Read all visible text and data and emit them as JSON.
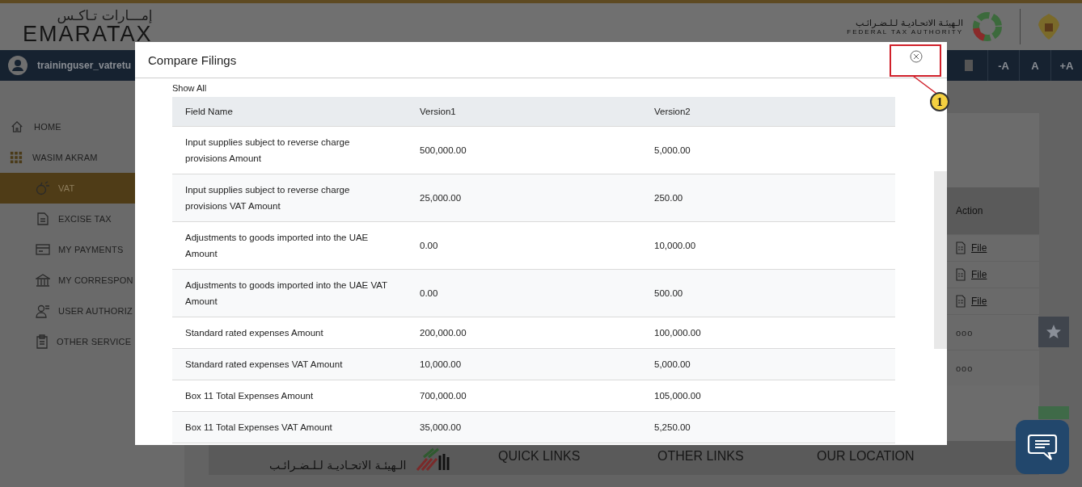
{
  "header": {
    "logo_arabic": "إمـــارات تـاكـس",
    "logo_text": "EMARATAX",
    "authority_arabic": "الـهيئـة الاتحـاديـة لـلـضـرائـب",
    "authority_english": "FEDERAL TAX AUTHORITY"
  },
  "navbar": {
    "username": "traininguser_vatretu",
    "font_buttons": [
      "-A",
      "A",
      "+A"
    ]
  },
  "sidebar": {
    "items": [
      {
        "label": "HOME",
        "selected": false
      },
      {
        "label": "WASIM AKRAM",
        "selected": false,
        "children": [
          {
            "label": "VAT",
            "selected": true
          },
          {
            "label": "EXCISE TAX",
            "selected": false
          },
          {
            "label": "MY PAYMENTS",
            "selected": false
          },
          {
            "label": "MY CORRESPON",
            "selected": false
          },
          {
            "label": "USER AUTHORIZ",
            "selected": false
          },
          {
            "label": "OTHER SERVICE",
            "selected": false
          }
        ]
      }
    ]
  },
  "background_table": {
    "column": "Action",
    "rows": [
      {
        "kind": "link",
        "text": "File"
      },
      {
        "kind": "link",
        "text": "File"
      },
      {
        "kind": "link",
        "text": "File"
      },
      {
        "kind": "more",
        "text": "ooo"
      },
      {
        "kind": "more",
        "text": "ooo"
      }
    ]
  },
  "footer": {
    "authority_arabic": "الـهيئـة الاتحـاديـة لـلـضـرائـب",
    "headings": [
      "QUICK LINKS",
      "OTHER LINKS",
      "OUR LOCATION"
    ]
  },
  "modal": {
    "title": "Compare Filings",
    "show_all": "Show All",
    "columns": [
      "Field Name",
      "Version1",
      "Version2"
    ],
    "rows": [
      [
        "Input supplies subject to reverse charge provisions Amount",
        "500,000.00",
        "5,000.00"
      ],
      [
        "Input supplies subject to reverse charge provisions VAT Amount",
        "25,000.00",
        "250.00"
      ],
      [
        "Adjustments to goods imported into the UAE Amount",
        "0.00",
        "10,000.00"
      ],
      [
        "Adjustments to goods imported into the UAE VAT Amount",
        "0.00",
        "500.00"
      ],
      [
        "Standard rated expenses Amount",
        "200,000.00",
        "100,000.00"
      ],
      [
        "Standard rated expenses VAT Amount",
        "10,000.00",
        "5,000.00"
      ],
      [
        "Box 11 Total Expenses Amount",
        "700,000.00",
        "105,000.00"
      ],
      [
        "Box 11 Total Expenses VAT Amount",
        "35,000.00",
        "5,250.00"
      ]
    ]
  },
  "annotation": {
    "number": "1"
  }
}
